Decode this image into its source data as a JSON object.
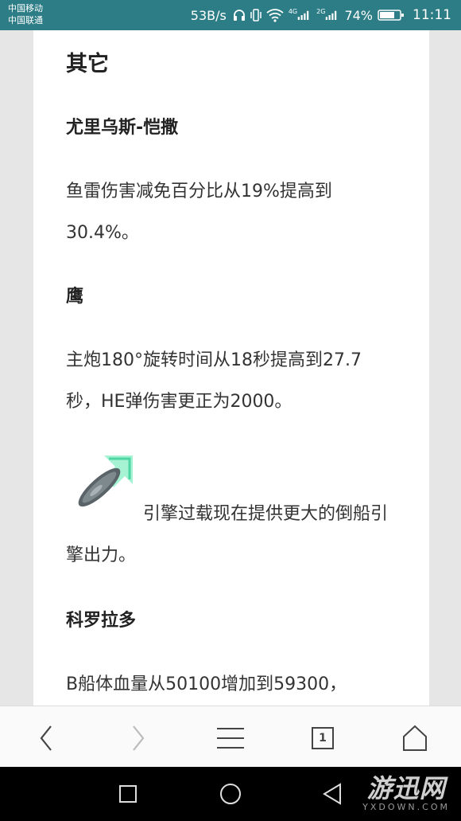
{
  "status_bar": {
    "carrier_1": "中国移动",
    "carrier_2": "中国联通",
    "net_speed": "53B/s",
    "net_type_1": "4G",
    "net_type_2": "2G",
    "battery": "74%",
    "time": "11:11"
  },
  "article": {
    "section_title": "其它",
    "items": [
      {
        "name": "尤里乌斯-恺撒",
        "text": "鱼雷伤害减免百分比从19%提高到30.4%。"
      },
      {
        "name": "鹰",
        "text": "主炮180°旋转时间从18秒提高到27.7秒，HE弹伤害更正为2000。"
      },
      {
        "name": "",
        "icon": "engine-boost-icon",
        "text": "引擎过载现在提供更大的倒船引擎出力。"
      },
      {
        "name": "科罗拉多",
        "text": "B船体血量从50100增加到59300，"
      }
    ]
  },
  "browser_bar": {
    "tab_count": "1"
  },
  "watermark": {
    "logo": "游迅网",
    "url": "YXDOWN.COM"
  },
  "colors": {
    "status_bar_bg": "#2c7d86",
    "page_bg": "#e6e6e6",
    "card_bg": "#ffffff"
  }
}
